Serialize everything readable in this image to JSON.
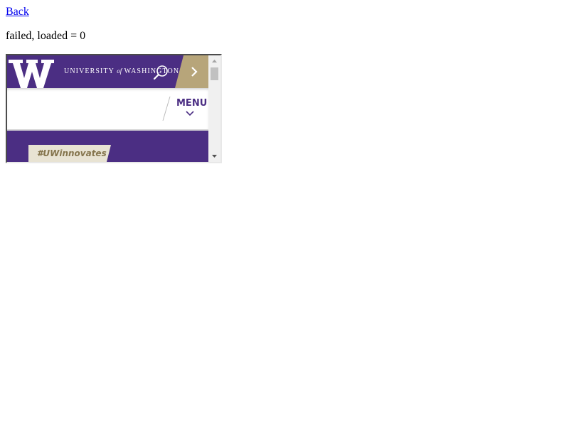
{
  "page": {
    "back_link": "Back",
    "status": "failed, loaded = 0"
  },
  "uw_site": {
    "brand": {
      "university": "UNIVERSITY",
      "of": "of",
      "washington": "WASHINGTON",
      "logo_letter": "W"
    },
    "icons": {
      "search": "search-icon",
      "quick_links": "chevron-right-icon",
      "menu_toggle": "chevron-down-icon"
    },
    "menu_label": "MENU",
    "hero_tag": "#UWinnovates",
    "colors": {
      "purple": "#4b2e83",
      "gold": "#b7a57a",
      "gold_text": "#85754d",
      "white": "#ffffff"
    }
  }
}
